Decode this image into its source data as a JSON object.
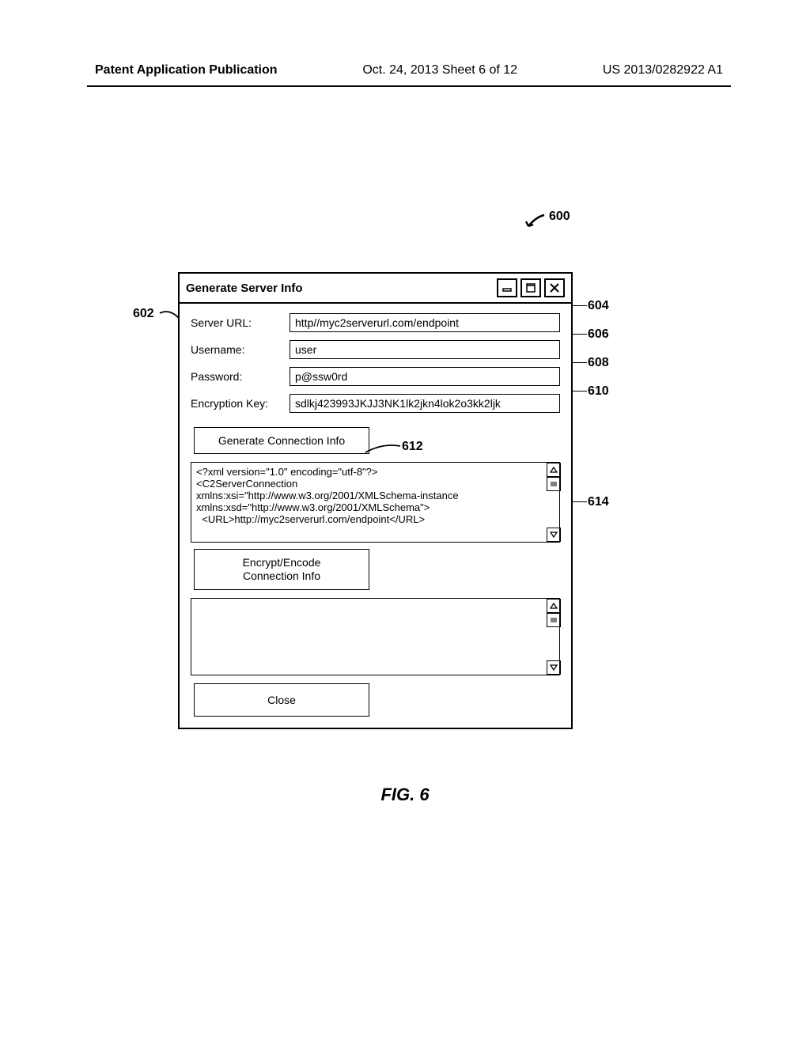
{
  "page_header": {
    "left": "Patent Application Publication",
    "mid": "Oct. 24, 2013  Sheet 6 of 12",
    "right": "US 2013/0282922 A1"
  },
  "figure_ref_600": "600",
  "window": {
    "title": "Generate Server Info",
    "fields": {
      "server_url_label": "Server URL:",
      "server_url_value": "http//myc2serverurl.com/endpoint",
      "username_label": "Username:",
      "username_value": "user",
      "password_label": "Password:",
      "password_value": "p@ssw0rd",
      "encryption_key_label": "Encryption Key:",
      "encryption_key_value": "sdlkj423993JKJJ3NK1lk2jkn4lok2o3kk2ljk"
    },
    "buttons": {
      "generate": "Generate Connection Info",
      "encrypt": "Encrypt/Encode\nConnection Info",
      "close": "Close"
    },
    "xml_output": "<?xml version=\"1.0\" encoding=\"utf-8\"?>\n<C2ServerConnection\nxmlns:xsi=\"http://www.w3.org/2001/XMLSchema-instance\nxmlns:xsd=\"http://www.w3.org/2001/XMLSchema\">\n  <URL>http://myc2serverurl.com/endpoint</URL>",
    "encoded_output": ""
  },
  "callouts": {
    "c602": "602",
    "c604": "604",
    "c606": "606",
    "c608": "608",
    "c610": "610",
    "c612": "612",
    "c614": "614"
  },
  "figure_caption": "FIG. 6"
}
